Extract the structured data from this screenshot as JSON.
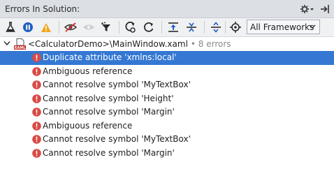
{
  "window": {
    "title": "Errors In Solution:",
    "pin_icon": "gear-dropdown-icon",
    "hide_icon": "hide-to-side-icon"
  },
  "toolbar": {
    "buttons": [
      "flask-icon",
      "stop-icon",
      "warning-icon",
      "hide-eye-icon",
      "eye-icon",
      "filter-icon",
      "refresh-settings-icon",
      "refresh-icon",
      "collapse-all-icon",
      "expand-all-icon",
      "crosshair-icon"
    ],
    "framework_selected": "All Frameworks"
  },
  "tree": {
    "file_path": "<CalculatorDemo>\\MainWindow.xaml",
    "file_count": "• 8 errors",
    "errors": [
      {
        "text": "Duplicate attribute 'xmlns:local'",
        "selected": true
      },
      {
        "text": "Ambiguous reference",
        "selected": false
      },
      {
        "text": "Cannot resolve symbol 'MyTextBox'",
        "selected": false
      },
      {
        "text": "Cannot resolve symbol 'Height'",
        "selected": false
      },
      {
        "text": "Cannot resolve symbol 'Margin'",
        "selected": false
      },
      {
        "text": "Ambiguous reference",
        "selected": false
      },
      {
        "text": "Cannot resolve symbol 'MyTextBox'",
        "selected": false
      },
      {
        "text": "Cannot resolve symbol 'Margin'",
        "selected": false
      }
    ]
  },
  "colors": {
    "selection": "#3478d3",
    "error": "#d94a45",
    "titlebar": "#dcdfe4",
    "toolbar": "#f0f1f3"
  }
}
